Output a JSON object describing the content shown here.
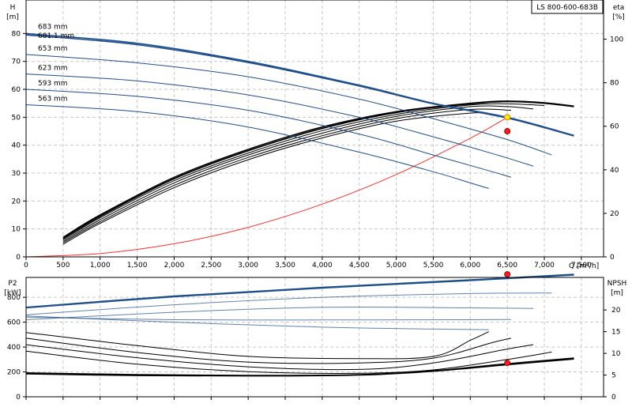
{
  "chart_data": [
    {
      "type": "line",
      "title": "LS 800-600-683B",
      "xlabel": "Q [m³/h]",
      "ylabel_left": [
        "H",
        "[m]"
      ],
      "ylabel_right": [
        "eta",
        "[%]"
      ],
      "xlim": [
        0,
        7800
      ],
      "ylim_left": [
        0,
        92
      ],
      "ylim_right": [
        0,
        118
      ],
      "x_ticks": [
        {
          "v": 0,
          "label": "0"
        },
        {
          "v": 500,
          "label": "500"
        },
        {
          "v": 1000,
          "label": "1,000"
        },
        {
          "v": 1500,
          "label": "1,500"
        },
        {
          "v": 2000,
          "label": "2,000"
        },
        {
          "v": 2500,
          "label": "2,500"
        },
        {
          "v": 3000,
          "label": "3,000"
        },
        {
          "v": 3500,
          "label": "3,500"
        },
        {
          "v": 4000,
          "label": "4,000"
        },
        {
          "v": 4500,
          "label": "4,500"
        },
        {
          "v": 5000,
          "label": "5,000"
        },
        {
          "v": 5500,
          "label": "5,500"
        },
        {
          "v": 6000,
          "label": "6,000"
        },
        {
          "v": 6500,
          "label": "6,500"
        },
        {
          "v": 7000,
          "label": "7,000"
        },
        {
          "v": 7500,
          "label": "7,500"
        }
      ],
      "y_ticks_left": [
        0,
        10,
        20,
        30,
        40,
        50,
        60,
        70,
        80
      ],
      "y_ticks_right": [
        0,
        20,
        40,
        60,
        80,
        100
      ],
      "grid": true,
      "head_curves": [
        {
          "name": "683 mm",
          "color": "#1f4e8c",
          "x": [
            0,
            1500,
            3000,
            4500,
            5500,
            6500,
            7400
          ],
          "y": [
            80,
            76.5,
            70,
            61.5,
            55,
            50,
            43.5
          ]
        },
        {
          "name": "681.1 mm",
          "color": "#1f4e8c",
          "x": [
            0,
            1500,
            3000,
            4500,
            5500,
            6500,
            7400
          ],
          "y": [
            79.5,
            76,
            69.6,
            61.2,
            54.8,
            49.7,
            43.3
          ]
        },
        {
          "name": "653 mm",
          "color": "#1f4e8c",
          "x": [
            0,
            1500,
            3000,
            4500,
            5500,
            6500,
            7100
          ],
          "y": [
            72.5,
            69.5,
            64.5,
            56.5,
            49.5,
            42,
            36.5
          ]
        },
        {
          "name": "623 mm",
          "color": "#1f4e8c",
          "x": [
            0,
            1500,
            3000,
            4500,
            5500,
            6300,
            6850
          ],
          "y": [
            65.5,
            63,
            58,
            50,
            43,
            37,
            32.5
          ]
        },
        {
          "name": "593 mm",
          "color": "#1f4e8c",
          "x": [
            0,
            1500,
            3000,
            4500,
            5500,
            6300,
            6550
          ],
          "y": [
            60,
            57.5,
            52.5,
            44,
            36.5,
            30.5,
            28.5
          ]
        },
        {
          "name": "563 mm",
          "color": "#1f4e8c",
          "x": [
            0,
            1500,
            3000,
            4500,
            5500,
            6000,
            6250
          ],
          "y": [
            54.5,
            52,
            46.5,
            37.5,
            30.5,
            26.5,
            24.5
          ]
        }
      ],
      "efficiency_curves": [
        {
          "x": [
            500,
            1000,
            2000,
            3000,
            4000,
            5000,
            6000,
            6500,
            7000,
            7400
          ],
          "y": [
            7,
            15,
            28.5,
            38.5,
            46.5,
            52,
            55,
            55.8,
            55.2,
            54
          ]
        },
        {
          "x": [
            500,
            1000,
            2000,
            3000,
            4000,
            5000,
            6000,
            6500,
            7000,
            7400
          ],
          "y": [
            6.5,
            14.5,
            28,
            38,
            46,
            51.7,
            54.8,
            55.6,
            55,
            53.8
          ]
        },
        {
          "x": [
            500,
            1000,
            2000,
            3000,
            4000,
            5000,
            6000,
            6500,
            7000
          ],
          "y": [
            6,
            14,
            27.3,
            37.2,
            45.2,
            51,
            54.4,
            54.8,
            54.2
          ]
        },
        {
          "x": [
            500,
            1000,
            2000,
            3000,
            4000,
            5000,
            6000,
            6500,
            6850
          ],
          "y": [
            5.5,
            13.3,
            26.5,
            36.5,
            44.3,
            50.3,
            53.8,
            53.8,
            53
          ]
        },
        {
          "x": [
            500,
            1000,
            2000,
            3000,
            4000,
            5000,
            6000,
            6550
          ],
          "y": [
            5,
            12.6,
            25.6,
            35.6,
            43.4,
            49.5,
            52.8,
            52.5
          ]
        },
        {
          "x": [
            500,
            1000,
            2000,
            3000,
            4000,
            5000,
            6000,
            6250
          ],
          "y": [
            4.5,
            12,
            24.8,
            34.8,
            42.6,
            48.6,
            51.5,
            51.2
          ]
        }
      ],
      "system_curve": {
        "color": "#ff3030",
        "x": [
          0,
          1000,
          2000,
          3000,
          4000,
          5000,
          6000,
          6500
        ],
        "y": [
          0,
          1.2,
          4.7,
          10.6,
          18.9,
          29.5,
          42.5,
          50
        ]
      },
      "duty_points": [
        {
          "x": 6500,
          "y": 50,
          "fill": "#ffee00",
          "stroke": "#e08000"
        },
        {
          "x": 6500,
          "y": 45,
          "fill": "#ee2020",
          "stroke": "#aa0000"
        }
      ]
    },
    {
      "type": "line",
      "title": "",
      "xlabel": "",
      "ylabel_left": [
        "P2",
        "[kW]"
      ],
      "ylabel_right": [
        "NPSH",
        "[m]"
      ],
      "xlim": [
        0,
        7800
      ],
      "ylim_left": [
        0,
        960
      ],
      "ylim_right": [
        0,
        27.5
      ],
      "y_ticks_left": [
        0,
        200,
        400,
        600,
        800
      ],
      "y_ticks_right": [
        0,
        5,
        10,
        15,
        20
      ],
      "grid": true,
      "power_curves": [
        {
          "color": "#1f4e8c",
          "x": [
            0,
            2000,
            4000,
            6000,
            7400
          ],
          "y": [
            720,
            810,
            880,
            940,
            985
          ]
        },
        {
          "color": "#1f4e8c",
          "x": [
            0,
            2000,
            4000,
            6000,
            7400
          ],
          "y": [
            715,
            805,
            875,
            935,
            980
          ]
        },
        {
          "color": "#1f4e8c",
          "x": [
            0,
            2000,
            4000,
            6000,
            7100
          ],
          "y": [
            660,
            740,
            800,
            830,
            835
          ]
        },
        {
          "color": "#1f4e8c",
          "x": [
            0,
            2000,
            4000,
            6000,
            6850
          ],
          "y": [
            620,
            680,
            720,
            715,
            710
          ]
        },
        {
          "color": "#1f4e8c",
          "x": [
            0,
            2000,
            4000,
            6000,
            6550
          ],
          "y": [
            640,
            620,
            618,
            620,
            622
          ]
        },
        {
          "color": "#1f4e8c",
          "x": [
            0,
            2000,
            4000,
            5500,
            6250
          ],
          "y": [
            650,
            600,
            560,
            545,
            540
          ]
        }
      ],
      "npsh_curves": [
        {
          "x": [
            0,
            1500,
            3000,
            4500,
            5500,
            6500,
            7400
          ],
          "y": [
            5.5,
            5.1,
            4.9,
            5.1,
            6.0,
            7.6,
            8.9
          ]
        },
        {
          "x": [
            0,
            1500,
            3000,
            4500,
            5500,
            6500,
            7400
          ],
          "y": [
            5.3,
            4.9,
            4.8,
            5.0,
            5.9,
            7.4,
            8.7
          ]
        },
        {
          "x": [
            0,
            1500,
            3000,
            4500,
            5500,
            6500,
            7100
          ],
          "y": [
            10.5,
            7.5,
            5.8,
            5.4,
            6.2,
            8.6,
            10.3
          ]
        },
        {
          "x": [
            0,
            1500,
            3000,
            4500,
            5500,
            6500,
            6850
          ],
          "y": [
            12.0,
            9.0,
            6.9,
            6.3,
            7.8,
            11.0,
            12.0
          ]
        },
        {
          "x": [
            0,
            1500,
            3000,
            4500,
            5500,
            6300,
            6550
          ],
          "y": [
            13.5,
            10.2,
            8.0,
            7.8,
            8.9,
            12.5,
            13.5
          ]
        },
        {
          "x": [
            0,
            1500,
            3000,
            4500,
            5500,
            6000,
            6250
          ],
          "y": [
            14.8,
            11.8,
            9.3,
            8.8,
            9.3,
            13.0,
            15.0
          ]
        }
      ],
      "duty_points": [
        {
          "axis": "left",
          "x": 6500,
          "y": 985,
          "fill": "#ee2020",
          "stroke": "#aa0000"
        },
        {
          "axis": "right",
          "x": 6500,
          "y": 7.8,
          "fill": "#ee2020",
          "stroke": "#aa0000"
        }
      ]
    }
  ]
}
